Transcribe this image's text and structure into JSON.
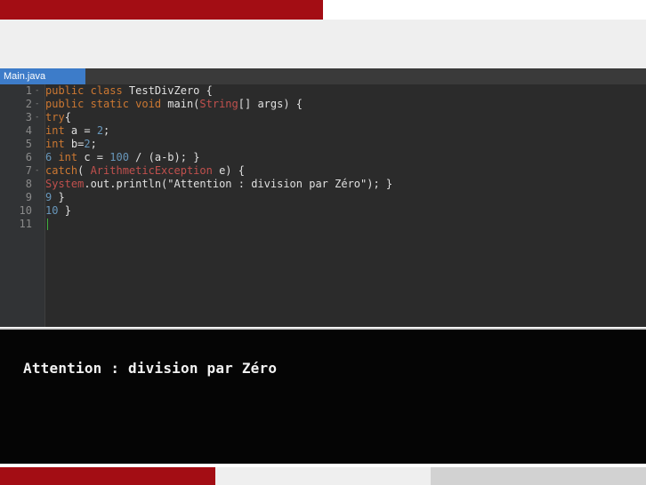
{
  "editor": {
    "tab_label": "Main.java",
    "lines": [
      {
        "number": "1",
        "fold": "-",
        "segments": [
          {
            "t": "public class ",
            "c": "kw"
          },
          {
            "t": "TestDivZero {",
            "c": "plain"
          }
        ]
      },
      {
        "number": "2",
        "fold": "-",
        "segments": [
          {
            "t": "public static void ",
            "c": "kw"
          },
          {
            "t": "main(",
            "c": "plain"
          },
          {
            "t": "String",
            "c": "cls"
          },
          {
            "t": "[] args) {",
            "c": "plain"
          }
        ]
      },
      {
        "number": "3",
        "fold": "-",
        "segments": [
          {
            "t": "try",
            "c": "kw"
          },
          {
            "t": "{",
            "c": "plain"
          }
        ]
      },
      {
        "number": "4",
        "fold": "",
        "segments": [
          {
            "t": "int ",
            "c": "kw"
          },
          {
            "t": "a = ",
            "c": "plain"
          },
          {
            "t": "2",
            "c": "num"
          },
          {
            "t": ";",
            "c": "plain"
          }
        ]
      },
      {
        "number": "5",
        "fold": "",
        "segments": [
          {
            "t": "int ",
            "c": "kw"
          },
          {
            "t": "b=",
            "c": "plain"
          },
          {
            "t": "2",
            "c": "num"
          },
          {
            "t": ";",
            "c": "plain"
          }
        ]
      },
      {
        "number": "6",
        "fold": "",
        "segments": [
          {
            "t": "6 ",
            "c": "num"
          },
          {
            "t": "int ",
            "c": "kw"
          },
          {
            "t": "c = ",
            "c": "plain"
          },
          {
            "t": "100",
            "c": "num"
          },
          {
            "t": " / (a-b); }",
            "c": "plain"
          }
        ]
      },
      {
        "number": "7",
        "fold": "-",
        "segments": [
          {
            "t": "catch",
            "c": "kw"
          },
          {
            "t": "( ",
            "c": "plain"
          },
          {
            "t": "ArithmeticException",
            "c": "cls"
          },
          {
            "t": " e) {",
            "c": "plain"
          }
        ]
      },
      {
        "number": "8",
        "fold": "",
        "segments": [
          {
            "t": "System",
            "c": "cls"
          },
          {
            "t": ".out.println(",
            "c": "plain"
          },
          {
            "t": "\"Attention : division par Zéro\"",
            "c": "plain"
          },
          {
            "t": "); }",
            "c": "plain"
          }
        ]
      },
      {
        "number": "9",
        "fold": "",
        "segments": [
          {
            "t": "9 ",
            "c": "num"
          },
          {
            "t": "}",
            "c": "plain"
          }
        ]
      },
      {
        "number": "10",
        "fold": "",
        "segments": [
          {
            "t": "10 ",
            "c": "num"
          },
          {
            "t": "}",
            "c": "plain"
          }
        ]
      },
      {
        "number": "11",
        "fold": "",
        "segments": []
      }
    ]
  },
  "console": {
    "output": "Attention : division par Zéro"
  },
  "colors": {
    "accent_red": "#a30d14",
    "tab_blue": "#3d7cc9",
    "editor_bg": "#2b2b2b",
    "console_bg": "#050505"
  }
}
